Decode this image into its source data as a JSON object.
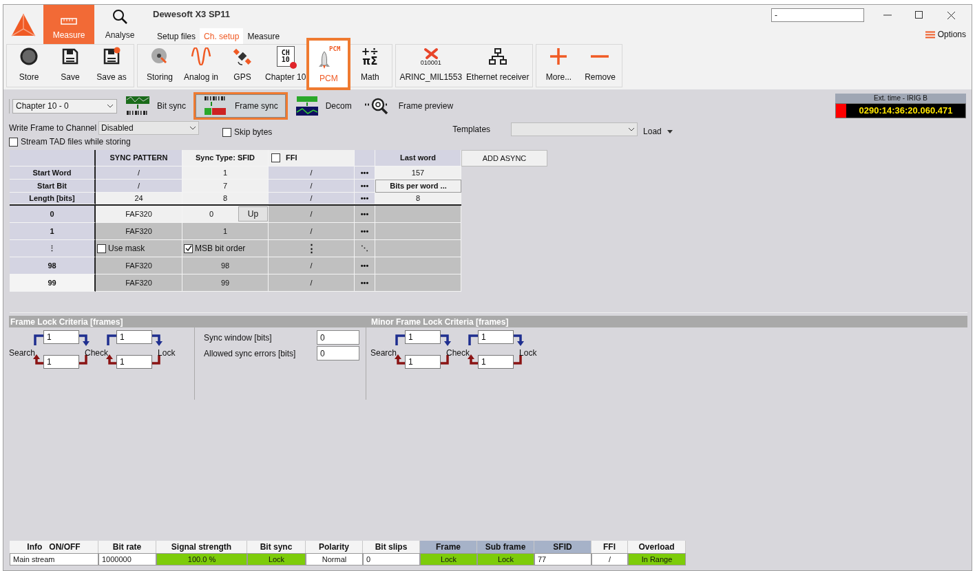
{
  "window": {
    "title": "Dewesoft X3 SP11",
    "search_value": "-",
    "options": "Options"
  },
  "modes": [
    {
      "label": "Measure",
      "selected": true
    },
    {
      "label": "Analyse",
      "selected": false
    }
  ],
  "nav_tabs": [
    {
      "label": "Setup files",
      "selected": false
    },
    {
      "label": "Ch. setup",
      "selected": true
    },
    {
      "label": "Measure",
      "selected": false
    }
  ],
  "toolbar_groups": [
    [
      {
        "label": "Store",
        "selected": false
      },
      {
        "label": "Save",
        "selected": false
      },
      {
        "label": "Save as",
        "selected": false
      }
    ],
    [
      {
        "label": "Storing",
        "selected": false
      },
      {
        "label": "Analog in",
        "selected": false
      },
      {
        "label": "GPS",
        "selected": false
      },
      {
        "label": "Chapter 10",
        "icon_text": "CH 10",
        "selected": false
      },
      {
        "label": "PCM",
        "icon_text": "PCM",
        "selected": true
      },
      {
        "label": "Math",
        "icon_text": "+÷πΣ",
        "selected": false
      }
    ],
    [
      {
        "label": "ARINC_MIL1553",
        "icon_text": "010001",
        "selected": false
      },
      {
        "label": "Ethernet receiver",
        "selected": false
      }
    ],
    [
      {
        "label": "More...",
        "selected": false
      },
      {
        "label": "Remove",
        "selected": false
      }
    ]
  ],
  "channel_select": "Chapter 10 - 0",
  "steps": [
    {
      "label": "Bit sync",
      "selected": false
    },
    {
      "label": "Frame sync",
      "selected": true
    },
    {
      "label": "Decom",
      "selected": false
    },
    {
      "label": "Frame preview",
      "selected": false
    }
  ],
  "ext_time": {
    "title": "Ext. time - IRIG B",
    "value": "0290:14:36:20.060.471",
    "color": "#ff0000"
  },
  "write_frame": {
    "label": "Write Frame to Channel",
    "value": "Disabled"
  },
  "skip_bytes": {
    "label": "Skip bytes",
    "checked": false
  },
  "templates": {
    "label": "Templates",
    "load": "Load"
  },
  "stream_tad": {
    "label": "Stream TAD files while storing",
    "checked": false
  },
  "table": {
    "columns": [
      {
        "label": "SYNC PATTERN"
      },
      {
        "label": "Sync Type: SFID"
      },
      {
        "label": "FFI",
        "checked": false
      },
      {
        "label": "Last word"
      }
    ],
    "add_button": "ADD ASYNC",
    "params": [
      {
        "label": "Start Word",
        "cells": [
          {
            "text": "/",
            "enabled": false
          },
          {
            "text": "1",
            "enabled": true
          },
          {
            "text": "/",
            "enabled": false
          }
        ],
        "menu": "•••",
        "last": "157"
      },
      {
        "label": "Start Bit",
        "cells": [
          {
            "text": "/",
            "enabled": false
          },
          {
            "text": "7",
            "enabled": true
          },
          {
            "text": "/",
            "enabled": false
          }
        ],
        "menu": "•••",
        "button": "Bits per word ..."
      },
      {
        "label": "Length [bits]",
        "cells": [
          {
            "text": "24",
            "enabled": true
          },
          {
            "text": "8",
            "enabled": true
          },
          {
            "text": "/",
            "enabled": false
          }
        ],
        "menu": "•••",
        "last": "8"
      }
    ],
    "rows": [
      {
        "kind": "data",
        "label": "0",
        "selected": true,
        "focused": false,
        "pattern": "FAF320",
        "sfid": "0",
        "button": "Up",
        "ffi": "/",
        "menu": "•••"
      },
      {
        "kind": "data",
        "label": "1",
        "selected": false,
        "focused": false,
        "pattern": "FAF320",
        "sfid": "1",
        "ffi": "/",
        "menu": "•••"
      },
      {
        "kind": "options",
        "label": "⋮",
        "selected": false,
        "focused": false,
        "use_mask": {
          "label": "Use mask",
          "checked": false
        },
        "msb": {
          "label": "MSB bit order",
          "checked": true
        },
        "ffi": "⋮",
        "menu": "⋱"
      },
      {
        "kind": "data",
        "label": "98",
        "selected": false,
        "focused": false,
        "pattern": "FAF320",
        "sfid": "98",
        "ffi": "/",
        "menu": "•••"
      },
      {
        "kind": "data",
        "label": "99",
        "selected": false,
        "focused": true,
        "pattern": "FAF320",
        "sfid": "99",
        "ffi": "/",
        "menu": "•••"
      }
    ]
  },
  "frame_lock": {
    "title": "Frame Lock Criteria [frames]",
    "labels": [
      "Search",
      "Check",
      "Lock"
    ],
    "loops": [
      {
        "forward": "1",
        "back": "1"
      },
      {
        "forward": "1",
        "back": "1"
      }
    ]
  },
  "sync_fields": [
    {
      "label": "Sync window [bits]",
      "value": "0"
    },
    {
      "label": "Allowed sync errors [bits]",
      "value": "0"
    }
  ],
  "minor_frame_lock": {
    "title": "Minor Frame Lock Criteria [frames]",
    "labels": [
      "Search",
      "Check",
      "Lock"
    ],
    "loops": [
      {
        "forward": "1",
        "back": "1"
      },
      {
        "forward": "1",
        "back": "1"
      }
    ]
  },
  "status": [
    {
      "label": "Info   ON/OFF",
      "highlight": false,
      "value": "Main stream",
      "ok": false
    },
    {
      "label": "Bit rate",
      "highlight": false,
      "value": "1000000",
      "ok": false
    },
    {
      "label": "Signal strength",
      "highlight": false,
      "value": "100.0 %",
      "ok": true
    },
    {
      "label": "Bit sync",
      "highlight": false,
      "value": "Lock",
      "ok": true
    },
    {
      "label": "Polarity",
      "highlight": false,
      "value": "Normal",
      "ok": false
    },
    {
      "label": "Bit slips",
      "highlight": false,
      "value": "0",
      "ok": false
    },
    {
      "label": "Frame",
      "highlight": true,
      "value": "Lock",
      "ok": true
    },
    {
      "label": "Sub frame",
      "highlight": true,
      "value": "Lock",
      "ok": true
    },
    {
      "label": "SFID",
      "highlight": true,
      "value": "77",
      "ok": false
    },
    {
      "label": "FFI",
      "highlight": false,
      "value": "/",
      "ok": false
    },
    {
      "label": "Overload",
      "highlight": false,
      "value": "In Range",
      "ok": true
    }
  ]
}
